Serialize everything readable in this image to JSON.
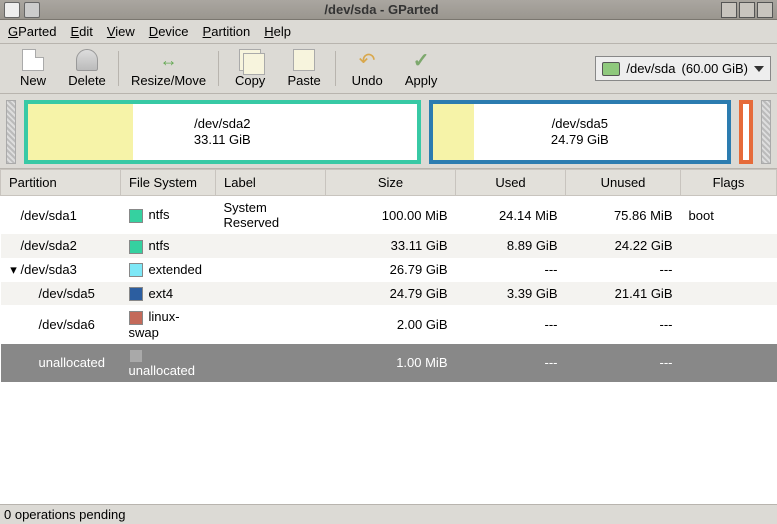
{
  "window": {
    "title": "/dev/sda - GParted"
  },
  "menu": {
    "gparted": "GParted",
    "edit": "Edit",
    "view": "View",
    "device": "Device",
    "partition": "Partition",
    "help": "Help"
  },
  "toolbar": {
    "new": "New",
    "delete": "Delete",
    "resize": "Resize/Move",
    "copy": "Copy",
    "paste": "Paste",
    "undo": "Undo",
    "apply": "Apply"
  },
  "device_selector": {
    "device": "/dev/sda",
    "size": "(60.00 GiB)"
  },
  "partmap": {
    "p1": {
      "label": "/dev/sda2",
      "size": "33.11 GiB"
    },
    "p2": {
      "label": "/dev/sda5",
      "size": "24.79 GiB"
    }
  },
  "columns": {
    "partition": "Partition",
    "fs": "File System",
    "label": "Label",
    "size": "Size",
    "used": "Used",
    "unused": "Unused",
    "flags": "Flags"
  },
  "rows": [
    {
      "indent": 0,
      "exp": "",
      "part": "/dev/sda1",
      "fs": "ntfs",
      "fscolor": "#35d1a0",
      "label": "System Reserved",
      "size": "100.00 MiB",
      "used": "24.14 MiB",
      "unused": "75.86 MiB",
      "flags": "boot",
      "alt": false,
      "sel": false
    },
    {
      "indent": 0,
      "exp": "",
      "part": "/dev/sda2",
      "fs": "ntfs",
      "fscolor": "#35d1a0",
      "label": "",
      "size": "33.11 GiB",
      "used": "8.89 GiB",
      "unused": "24.22 GiB",
      "flags": "",
      "alt": true,
      "sel": false
    },
    {
      "indent": 0,
      "exp": "▾",
      "part": "/dev/sda3",
      "fs": "extended",
      "fscolor": "#7de8f7",
      "label": "",
      "size": "26.79 GiB",
      "used": "---",
      "unused": "---",
      "flags": "",
      "alt": false,
      "sel": false
    },
    {
      "indent": 1,
      "exp": "",
      "part": "/dev/sda5",
      "fs": "ext4",
      "fscolor": "#2c5ea0",
      "label": "",
      "size": "24.79 GiB",
      "used": "3.39 GiB",
      "unused": "21.41 GiB",
      "flags": "",
      "alt": true,
      "sel": false
    },
    {
      "indent": 1,
      "exp": "",
      "part": "/dev/sda6",
      "fs": "linux-swap",
      "fscolor": "#c46a5a",
      "label": "",
      "size": "2.00 GiB",
      "used": "---",
      "unused": "---",
      "flags": "",
      "alt": false,
      "sel": false
    },
    {
      "indent": 1,
      "exp": "",
      "part": "unallocated",
      "fs": "unallocated",
      "fscolor": "#a9a9a9",
      "label": "",
      "size": "1.00 MiB",
      "used": "---",
      "unused": "---",
      "flags": "",
      "alt": false,
      "sel": true
    }
  ],
  "status": "0 operations pending"
}
